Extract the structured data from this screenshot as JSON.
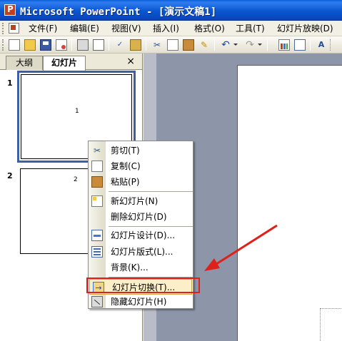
{
  "window": {
    "title": "Microsoft PowerPoint - [演示文稿1]"
  },
  "menu": [
    {
      "label": "文件(F)"
    },
    {
      "label": "编辑(E)"
    },
    {
      "label": "视图(V)"
    },
    {
      "label": "插入(I)"
    },
    {
      "label": "格式(O)"
    },
    {
      "label": "工具(T)"
    },
    {
      "label": "幻灯片放映(D)"
    }
  ],
  "toolbar": {
    "icons": [
      "new-icon",
      "open-icon",
      "save-icon",
      "permission-icon",
      "print-icon",
      "print-preview-icon",
      "spelling-icon",
      "research-icon",
      "cut-icon",
      "copy-icon",
      "paste-icon",
      "format-painter-icon",
      "undo-icon",
      "redo-icon",
      "chart-icon",
      "table-icon",
      "textbox-icon"
    ]
  },
  "pane": {
    "tabs": [
      {
        "label": "大纲"
      },
      {
        "label": "幻灯片"
      }
    ],
    "close": "×",
    "slides": [
      {
        "number": "1",
        "label": "1"
      },
      {
        "number": "2",
        "label": "2"
      }
    ]
  },
  "context_menu": {
    "items": [
      {
        "label": "剪切(T)",
        "icon": "cut-icon"
      },
      {
        "label": "复制(C)",
        "icon": "copy-icon"
      },
      {
        "label": "粘贴(P)",
        "icon": "paste-icon"
      },
      {
        "label": "新幻灯片(N)",
        "icon": "new-slide-icon"
      },
      {
        "label": "删除幻灯片(D)",
        "icon": ""
      },
      {
        "label": "幻灯片设计(D)...",
        "icon": "slide-design-icon"
      },
      {
        "label": "幻灯片版式(L)...",
        "icon": "slide-layout-icon"
      },
      {
        "label": "背景(K)...",
        "icon": ""
      },
      {
        "label": "幻灯片切换(T)...",
        "icon": "slide-transition-icon",
        "highlighted": true
      },
      {
        "label": "隐藏幻灯片(H)",
        "icon": "hide-slide-icon"
      }
    ]
  },
  "colors": {
    "title_bar": "#0a56d0",
    "highlight_fill": "#fbeec8",
    "annotation_red": "#e0201b",
    "workspace": "#8d95a8"
  }
}
